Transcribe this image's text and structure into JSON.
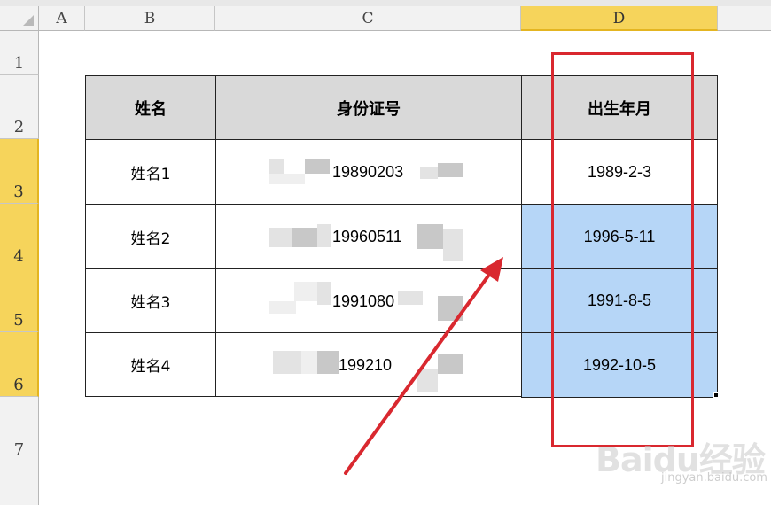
{
  "columns": [
    "A",
    "B",
    "C",
    "D"
  ],
  "rows": [
    "1",
    "2",
    "3",
    "4",
    "5",
    "6",
    "7"
  ],
  "table": {
    "headers": [
      "姓名",
      "身份证号",
      "出生年月"
    ],
    "records": [
      {
        "name": "姓名1",
        "id_partial": "19890203",
        "birth": "1989-2-3"
      },
      {
        "name": "姓名2",
        "id_partial": "19960511",
        "birth": "1996-5-11"
      },
      {
        "name": "姓名3",
        "id_partial": "1991080",
        "birth": "1991-8-5"
      },
      {
        "name": "姓名4",
        "id_partial": "199210",
        "birth": "1992-10-5"
      }
    ]
  },
  "colors": {
    "selected_header": "#f6d45b",
    "selected_cells": "#b6d6f7",
    "highlight_box": "#d9282f",
    "arrow": "#d9282f"
  },
  "watermark": {
    "main": "Baidu经验",
    "sub": "jingyan.baidu.com"
  }
}
